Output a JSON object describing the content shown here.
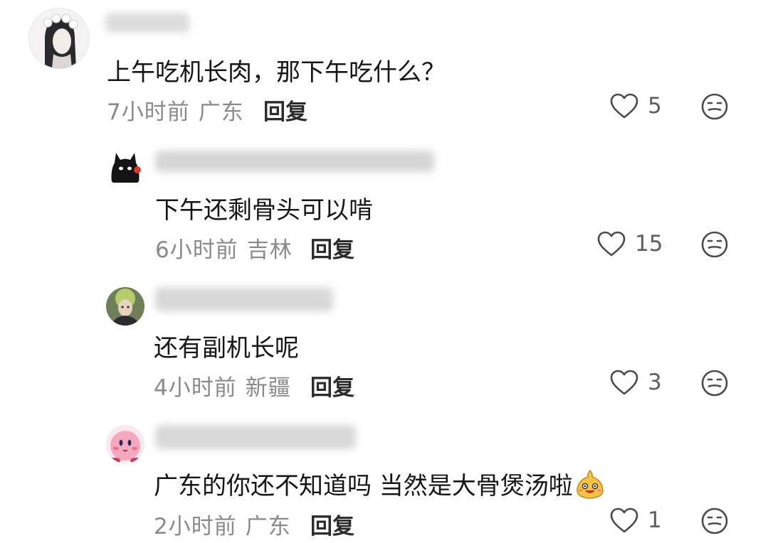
{
  "comments": [
    {
      "text": "上午吃机长肉，那下午吃什么？",
      "time": "7小时前",
      "region": "广东",
      "reply": "回复",
      "likes": "5",
      "is_reply": false
    },
    {
      "text": "下午还剩骨头可以啃",
      "time": "6小时前",
      "region": "吉林",
      "reply": "回复",
      "likes": "15",
      "is_reply": true
    },
    {
      "text": "还有副机长呢",
      "time": "4小时前",
      "region": "新疆",
      "reply": "回复",
      "likes": "3",
      "is_reply": true
    },
    {
      "text": "广东的你还不知道吗 当然是大骨煲汤啦",
      "emoji_icon": "smiling-bun-emoji-icon",
      "time": "2小时前",
      "region": "广东",
      "reply": "回复",
      "likes": "1",
      "is_reply": true
    }
  ],
  "icons": {
    "like": "heart-outline-icon",
    "dislike": "meh-face-icon"
  },
  "colors": {
    "text": "#161616",
    "meta": "#8a8a8a",
    "icon": "#4a4a4a"
  }
}
